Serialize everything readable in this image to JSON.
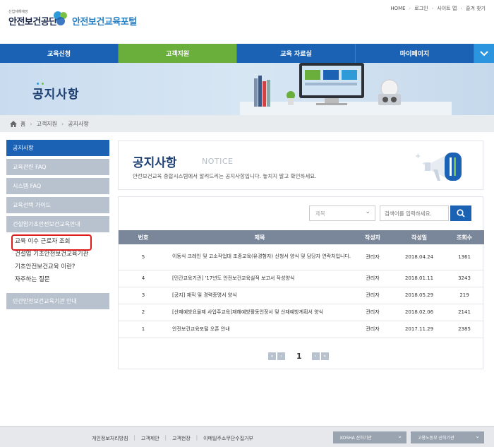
{
  "header": {
    "kosha_sub": "산업재해예방",
    "kosha_name": "안전보건공단",
    "portal_name": "안전보건교육포털",
    "util": [
      "HOME",
      "로그인",
      "사이트 맵",
      "즐겨 찾기"
    ]
  },
  "gnb": {
    "items": [
      {
        "label": "교육신청"
      },
      {
        "label": "고객지원"
      },
      {
        "label": "교육 자료실"
      },
      {
        "label": "마이페이지"
      }
    ],
    "active_index": 1,
    "more_icon": "chevron-down-icon"
  },
  "banner": {
    "title": "공지사항"
  },
  "breadcrumb": {
    "home": "홈",
    "level1": "고객지원",
    "level2": "공지사항"
  },
  "left_menu": {
    "items": [
      {
        "label": "공지사항"
      },
      {
        "label": "교육관련 FAQ"
      },
      {
        "label": "시스템 FAQ"
      },
      {
        "label": "교육선택 가이드"
      },
      {
        "label": "건설업기초안전보건교육안내"
      }
    ],
    "submenu": [
      {
        "label": "교육 이수 근로자 조회"
      },
      {
        "label": "건설업 기초안전보건교육기관"
      },
      {
        "label": "기초안전보건교육 이란?"
      },
      {
        "label": "자주하는 질문"
      }
    ],
    "last": {
      "label": "민간안전보건교육기관 안내"
    }
  },
  "notice": {
    "title": "공지사항",
    "title_en": "NOTICE",
    "desc": "안전보건교육 종합시스템에서 알려드리는 공지사항입니다. 놓치지 말고 확인하세요."
  },
  "search": {
    "select_value": "제목",
    "placeholder": "검색어를 입력하세요."
  },
  "table": {
    "headers": {
      "no": "번호",
      "title": "제목",
      "author": "작성자",
      "date": "작성일",
      "views": "조회수"
    },
    "rows": [
      {
        "no": "5",
        "title": "이동식 크레인 및 고소작업대 조종교육(유경험자) 신청서 양식 및 담당자 연락처입니다.",
        "author": "관리자",
        "date": "2018.04.24",
        "views": "1361"
      },
      {
        "no": "4",
        "title": "[민간교육기관] '17년도 안전보건교육실적 보고서 작성양식",
        "author": "관리자",
        "date": "2018.01.11",
        "views": "3243"
      },
      {
        "no": "3",
        "title": "[공지] 재직 및 경력증명서 양식",
        "author": "관리자",
        "date": "2018.05.29",
        "views": "219"
      },
      {
        "no": "2",
        "title": "[산재예방요율제 사업주교육]재해예방활동인정서 및 산재예방계획서 양식",
        "author": "관리자",
        "date": "2018.02.06",
        "views": "2141"
      },
      {
        "no": "1",
        "title": "안전보건교육포털 오픈 안내",
        "author": "관리자",
        "date": "2017.11.29",
        "views": "2385"
      }
    ]
  },
  "pager": {
    "current": "1"
  },
  "footer": {
    "links": [
      "개인정보처리방침",
      "고객제안",
      "고객헌장",
      "이메일주소무단수집거부"
    ],
    "select1": "KOSHA 산하기관",
    "select2": "고용노동부 산하기관"
  },
  "colors": {
    "primary": "#1b62b5",
    "active_green": "#6aae3c",
    "highlight_red": "#e01b1b"
  }
}
